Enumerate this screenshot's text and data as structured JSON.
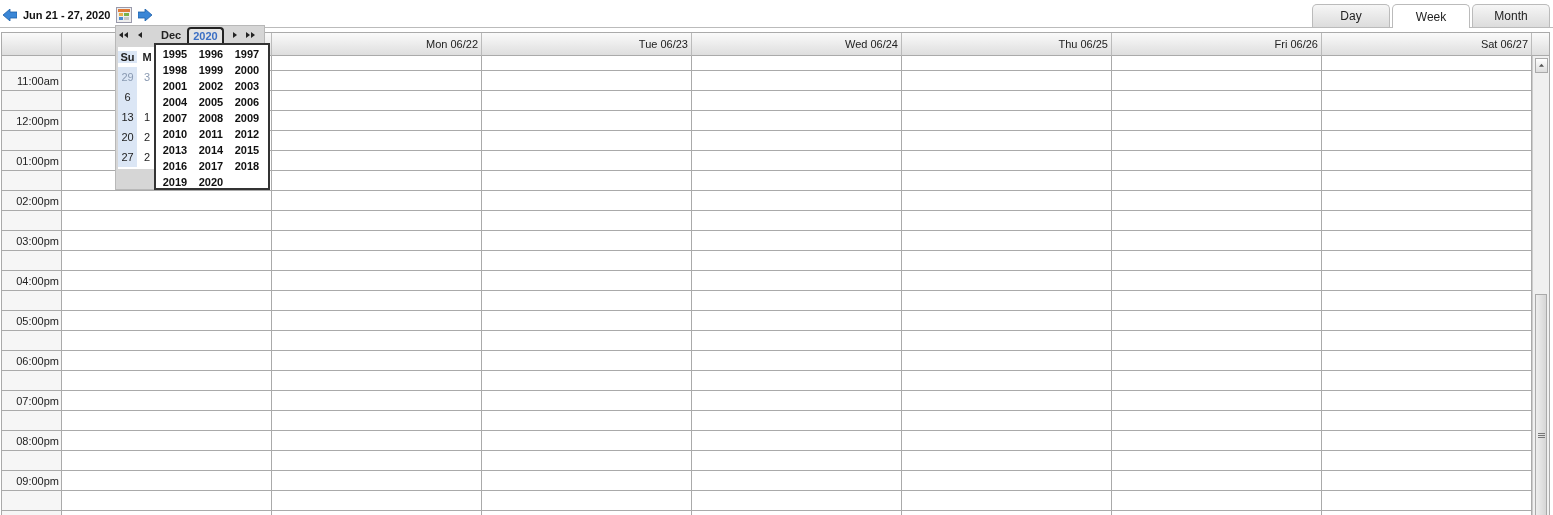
{
  "toolbar": {
    "title": "Jun 21 - 27, 2020"
  },
  "tabs": [
    {
      "label": "Day",
      "selected": false
    },
    {
      "label": "Week",
      "selected": true
    },
    {
      "label": "Month",
      "selected": false
    }
  ],
  "columns": [
    "Mon 06/22",
    "Tue 06/23",
    "Wed 06/24",
    "Thu 06/25",
    "Fri 06/26",
    "Sat 06/27"
  ],
  "time_rows": [
    "11:00am",
    "12:00pm",
    "01:00pm",
    "02:00pm",
    "03:00pm",
    "04:00pm",
    "05:00pm",
    "06:00pm",
    "07:00pm",
    "08:00pm",
    "09:00pm"
  ],
  "datepicker": {
    "month": "Dec",
    "year": "2020",
    "weekdays": [
      "Su",
      "M"
    ],
    "weeks": [
      [
        {
          "day": "29",
          "other_month": true
        },
        {
          "day": "3",
          "other_month": true
        }
      ],
      [
        {
          "day": "6",
          "other_month": false
        }
      ],
      [
        {
          "day": "13",
          "other_month": false
        },
        {
          "day": "1",
          "other_month": false
        }
      ],
      [
        {
          "day": "20",
          "other_month": false
        },
        {
          "day": "2",
          "other_month": false
        }
      ],
      [
        {
          "day": "27",
          "other_month": false
        },
        {
          "day": "2",
          "other_month": false
        }
      ]
    ],
    "years": [
      "1995",
      "1996",
      "1997",
      "1998",
      "1999",
      "2000",
      "2001",
      "2002",
      "2003",
      "2004",
      "2005",
      "2006",
      "2007",
      "2008",
      "2009",
      "2010",
      "2011",
      "2012",
      "2013",
      "2014",
      "2015",
      "2016",
      "2017",
      "2018",
      "2019",
      "2020"
    ]
  }
}
